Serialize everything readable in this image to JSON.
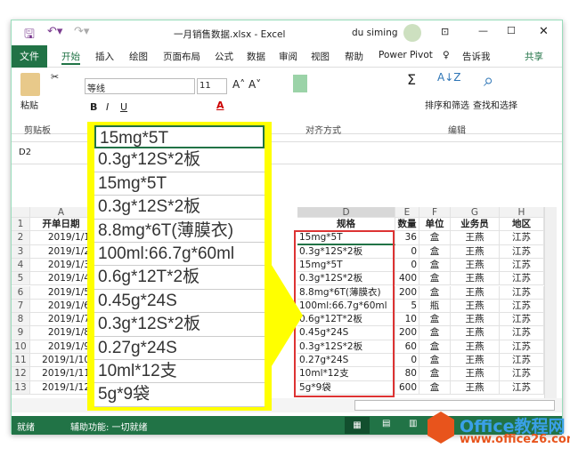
{
  "title": "一月销售数据.xlsx  -  Excel",
  "user": "du siming",
  "tabs": [
    "文件",
    "开始",
    "插入",
    "绘图",
    "页面布局",
    "公式",
    "数据",
    "审阅",
    "视图",
    "帮助",
    "Power Pivot",
    "告诉我",
    "共享"
  ],
  "ribbon": {
    "paste": "粘贴",
    "font_name": "等线",
    "font_size": "11",
    "groups": [
      "剪贴板",
      "对齐方式",
      "编辑"
    ],
    "sort_filter": "排序和筛选",
    "find_select": "查找和选择"
  },
  "name_box": "D2",
  "columns": [
    "A",
    "D",
    "E",
    "F",
    "G",
    "H"
  ],
  "header_row": [
    "开单日期",
    "规格",
    "数量",
    "单位",
    "业务员",
    "地区"
  ],
  "rows": [
    [
      "2019/1/1",
      "15mg*5T",
      "36",
      "盒",
      "王燕",
      "江苏"
    ],
    [
      "2019/1/2",
      "0.3g*12S*2板",
      "0",
      "盒",
      "王燕",
      "江苏"
    ],
    [
      "2019/1/3",
      "15mg*5T",
      "0",
      "盒",
      "王燕",
      "江苏"
    ],
    [
      "2019/1/4",
      "0.3g*12S*2板",
      "400",
      "盒",
      "王燕",
      "江苏"
    ],
    [
      "2019/1/5",
      "8.8mg*6T(薄膜衣)",
      "200",
      "盒",
      "王燕",
      "江苏"
    ],
    [
      "2019/1/6",
      "100ml:66.7g*60ml",
      "5",
      "瓶",
      "王燕",
      "江苏"
    ],
    [
      "2019/1/7",
      "0.6g*12T*2板",
      "10",
      "盒",
      "王燕",
      "江苏"
    ],
    [
      "2019/1/8",
      "0.45g*24S",
      "200",
      "盒",
      "王燕",
      "江苏"
    ],
    [
      "2019/1/9",
      "0.3g*12S*2板",
      "60",
      "盒",
      "王燕",
      "江苏"
    ],
    [
      "2019/1/10",
      "0.27g*24S",
      "0",
      "盒",
      "王燕",
      "江苏"
    ],
    [
      "2019/1/11",
      "10ml*12支",
      "80",
      "盒",
      "王燕",
      "江苏"
    ],
    [
      "2019/1/12",
      "5g*9袋",
      "600",
      "盒",
      "王燕",
      "江苏"
    ]
  ],
  "zoom_list": [
    "15mg*5T",
    "0.3g*12S*2板",
    "15mg*5T",
    "0.3g*12S*2板",
    "8.8mg*6T(薄膜衣)",
    "100ml:66.7g*60ml",
    "0.6g*12T*2板",
    "0.45g*24S",
    "0.3g*12S*2板",
    "0.27g*24S",
    "10ml*12支",
    "5g*9袋"
  ],
  "status": {
    "ready": "就绪",
    "accessibility": "辅助功能: 一切就绪"
  },
  "watermark": {
    "name": "Office教程网",
    "url": "www.office26.com"
  },
  "colors": {
    "excel_green": "#217346",
    "highlight": "#ffff00",
    "red_box": "#dd3333"
  }
}
